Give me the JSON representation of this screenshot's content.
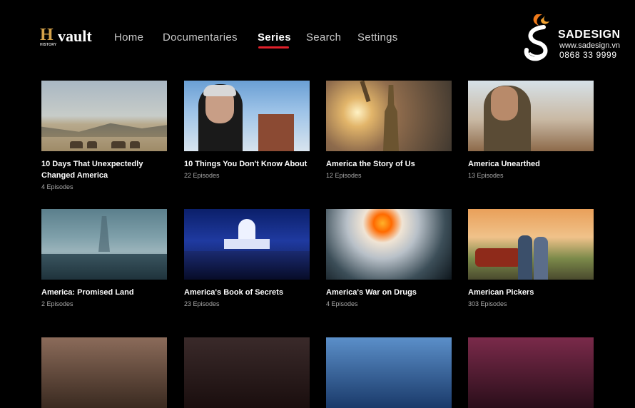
{
  "app": {
    "logo_brand": "H",
    "logo_sub": "HISTORY",
    "logo_name": "vault"
  },
  "nav": {
    "items": [
      {
        "label": "Home"
      },
      {
        "label": "Documentaries"
      },
      {
        "label": "Series"
      },
      {
        "label": "Search"
      },
      {
        "label": "Settings"
      }
    ],
    "active": "Series"
  },
  "watermark": {
    "brand": "SADESIGN",
    "url": "www.sadesign.vn",
    "phone": "0868 33 9999"
  },
  "series": [
    {
      "title": "10 Days That Unexpectedly Changed America",
      "episodes": "4 Episodes"
    },
    {
      "title": "10 Things You Don't Know About",
      "episodes": "22 Episodes"
    },
    {
      "title": "America the Story of Us",
      "episodes": "12 Episodes"
    },
    {
      "title": "America Unearthed",
      "episodes": "13 Episodes"
    },
    {
      "title": "America: Promised Land",
      "episodes": "2 Episodes"
    },
    {
      "title": "America's Book of Secrets",
      "episodes": "23 Episodes"
    },
    {
      "title": "America's War on Drugs",
      "episodes": "4 Episodes"
    },
    {
      "title": "American Pickers",
      "episodes": "303 Episodes"
    }
  ],
  "colors": {
    "accent": "#e0202a",
    "logo_gold": "#d5a24a",
    "watermark_orange": "#f07a1a"
  }
}
